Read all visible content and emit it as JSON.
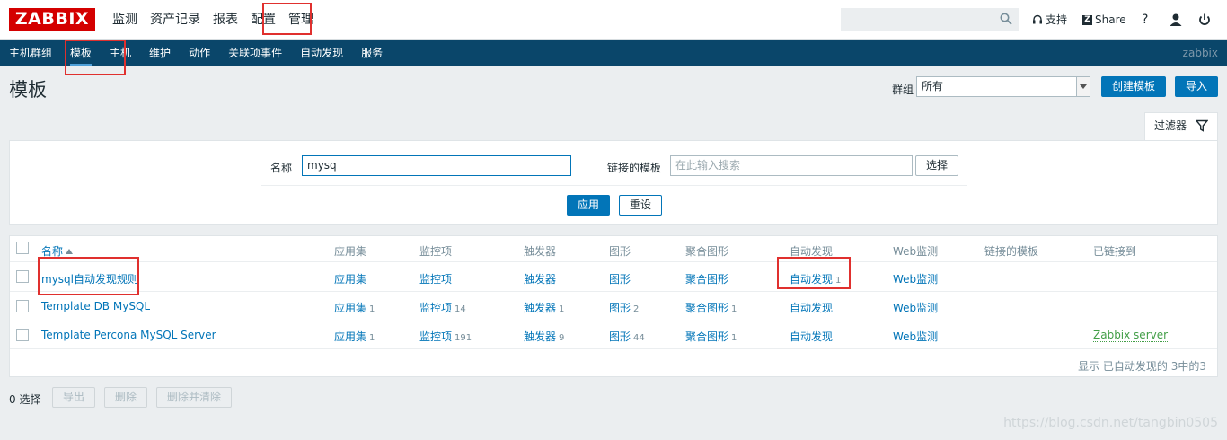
{
  "logo": "ZABBIX",
  "main_menu": [
    "监测",
    "资产记录",
    "报表",
    "配置",
    "管理"
  ],
  "top_right": {
    "support": "支持",
    "share": "Share",
    "help": "?"
  },
  "search": {
    "value": "",
    "placeholder": ""
  },
  "sub_menu": [
    "主机群组",
    "模板",
    "主机",
    "维护",
    "动作",
    "关联项事件",
    "自动发现",
    "服务"
  ],
  "server_name": "zabbix",
  "page_title": "模板",
  "group": {
    "label": "群组",
    "value": "所有"
  },
  "buttons": {
    "create": "创建模板",
    "import": "导入"
  },
  "filter": {
    "tab": "过滤器",
    "name_label": "名称",
    "name_value": "mysq",
    "linked_label": "链接的模板",
    "linked_placeholder": "在此输入搜索",
    "select": "选择",
    "apply": "应用",
    "reset": "重设"
  },
  "table": {
    "headers": [
      "名称",
      "应用集",
      "监控项",
      "触发器",
      "图形",
      "聚合图形",
      "自动发现",
      "Web监测",
      "链接的模板",
      "已链接到"
    ],
    "rows": [
      {
        "name": "mysql自动发现规则",
        "apps": "应用集",
        "apps_n": "",
        "items": "监控项",
        "items_n": "",
        "triggers": "触发器",
        "triggers_n": "",
        "graphs": "图形",
        "graphs_n": "",
        "screens": "聚合图形",
        "screens_n": "",
        "discovery": "自动发现",
        "discovery_n": "1",
        "web": "Web监测",
        "linked_to": ""
      },
      {
        "name": "Template DB MySQL",
        "apps": "应用集",
        "apps_n": "1",
        "items": "监控项",
        "items_n": "14",
        "triggers": "触发器",
        "triggers_n": "1",
        "graphs": "图形",
        "graphs_n": "2",
        "screens": "聚合图形",
        "screens_n": "1",
        "discovery": "自动发现",
        "discovery_n": "",
        "web": "Web监测",
        "linked_to": ""
      },
      {
        "name": "Template Percona MySQL Server",
        "apps": "应用集",
        "apps_n": "1",
        "items": "监控项",
        "items_n": "191",
        "triggers": "触发器",
        "triggers_n": "9",
        "graphs": "图形",
        "graphs_n": "44",
        "screens": "聚合图形",
        "screens_n": "1",
        "discovery": "自动发现",
        "discovery_n": "",
        "web": "Web监测",
        "linked_to": "Zabbix server"
      }
    ],
    "footer": "显示 已自动发现的 3中的3"
  },
  "bottom": {
    "selected": "0 选择",
    "export": "导出",
    "delete": "删除",
    "delete_clear": "删除并清除"
  },
  "watermark": "https://blog.csdn.net/tangbin0505",
  "colors": {
    "brand": "#d40000",
    "nav": "#0a466a",
    "link": "#0275b8",
    "green": "#429e47",
    "annotation": "#e0302e"
  }
}
